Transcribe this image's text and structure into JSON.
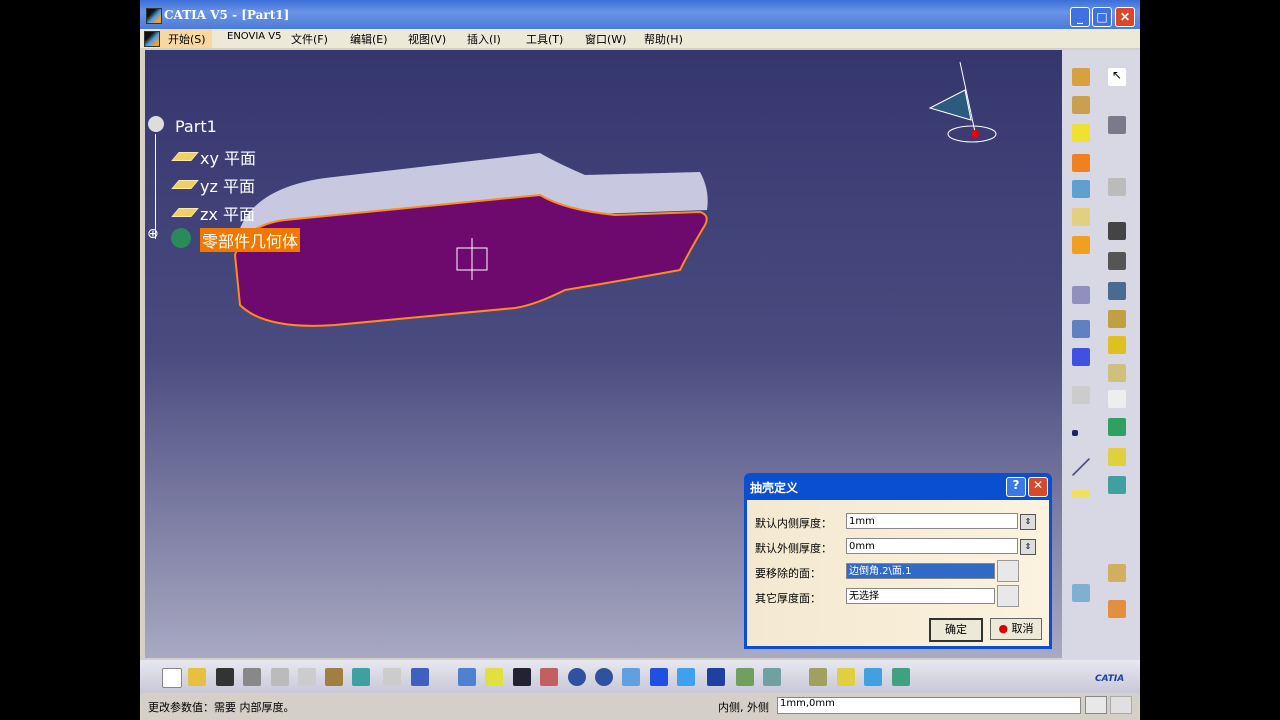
{
  "window": {
    "title": "CATIA V5 - [Part1]",
    "minimize": "_",
    "maximize": "□",
    "close": "✕"
  },
  "menu": [
    "开始(S)",
    "ENOVIA V5",
    "文件(F)",
    "编辑(E)",
    "视图(V)",
    "插入(I)",
    "工具(T)",
    "窗口(W)",
    "帮助(H)"
  ],
  "tree": {
    "root": "Part1",
    "items": [
      "xy 平面",
      "yz 平面",
      "zx 平面"
    ],
    "body": "零部件几何体"
  },
  "dialog": {
    "title": "抽壳定义",
    "help": "?",
    "close": "✕",
    "fields": [
      {
        "label": "默认内侧厚度：",
        "value": "1mm"
      },
      {
        "label": "默认外侧厚度：",
        "value": "0mm"
      },
      {
        "label": "要移除的面：",
        "value": "边倒角.2\\面.1"
      },
      {
        "label": "其它厚度面：",
        "value": "无选择"
      }
    ],
    "ok": "确定",
    "cancel": "取消"
  },
  "status": {
    "message": "更改参数值：需要 内部厚度。",
    "param_label": "内侧, 外侧",
    "param_value": "1mm,0mm"
  },
  "logo": "CATIA",
  "colors": {
    "face": "#6e0a6e",
    "edge": "#ff8a1e",
    "highlight": "#f07800"
  }
}
